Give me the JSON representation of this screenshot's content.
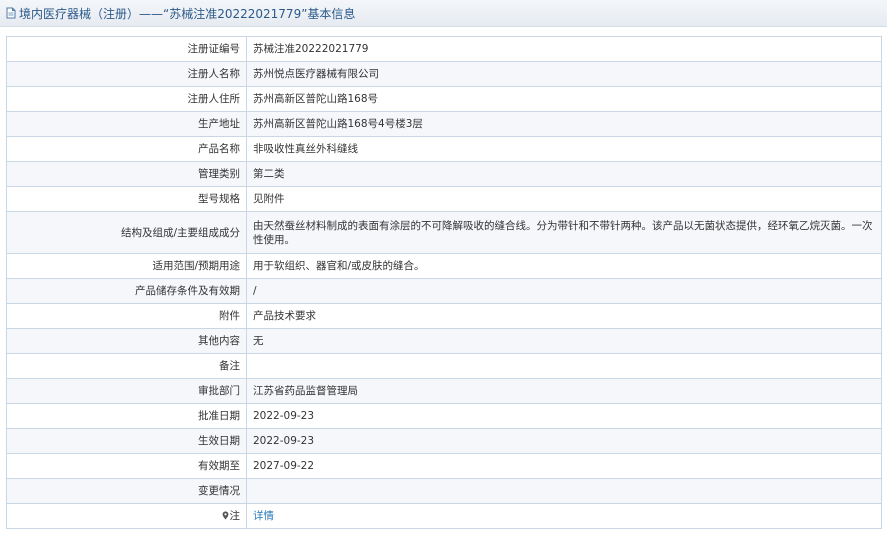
{
  "header": {
    "title": "境内医疗器械（注册）——“苏械注准20222021779”基本信息"
  },
  "rows": [
    {
      "label": "注册证编号",
      "value": "苏械注准20222021779"
    },
    {
      "label": "注册人名称",
      "value": "苏州悦点医疗器械有限公司"
    },
    {
      "label": "注册人住所",
      "value": "苏州高新区普陀山路168号"
    },
    {
      "label": "生产地址",
      "value": "苏州高新区普陀山路168号4号楼3层"
    },
    {
      "label": "产品名称",
      "value": "非吸收性真丝外科缝线"
    },
    {
      "label": "管理类别",
      "value": "第二类"
    },
    {
      "label": "型号规格",
      "value": "见附件"
    },
    {
      "label": "结构及组成/主要组成成分",
      "value": "由天然蚕丝材料制成的表面有涂层的不可降解吸收的缝合线。分为带针和不带针两种。该产品以无菌状态提供，经环氧乙烷灭菌。一次性使用。"
    },
    {
      "label": "适用范围/预期用途",
      "value": "用于软组织、器官和/或皮肤的缝合。"
    },
    {
      "label": "产品储存条件及有效期",
      "value": "/"
    },
    {
      "label": "附件",
      "value": "产品技术要求"
    },
    {
      "label": "其他内容",
      "value": "无"
    },
    {
      "label": "备注",
      "value": ""
    },
    {
      "label": "审批部门",
      "value": "江苏省药品监督管理局"
    },
    {
      "label": "批准日期",
      "value": "2022-09-23"
    },
    {
      "label": "生效日期",
      "value": "2022-09-23"
    },
    {
      "label": "有效期至",
      "value": "2027-09-22"
    },
    {
      "label": "变更情况",
      "value": ""
    },
    {
      "label": "注",
      "value": "详情"
    }
  ]
}
